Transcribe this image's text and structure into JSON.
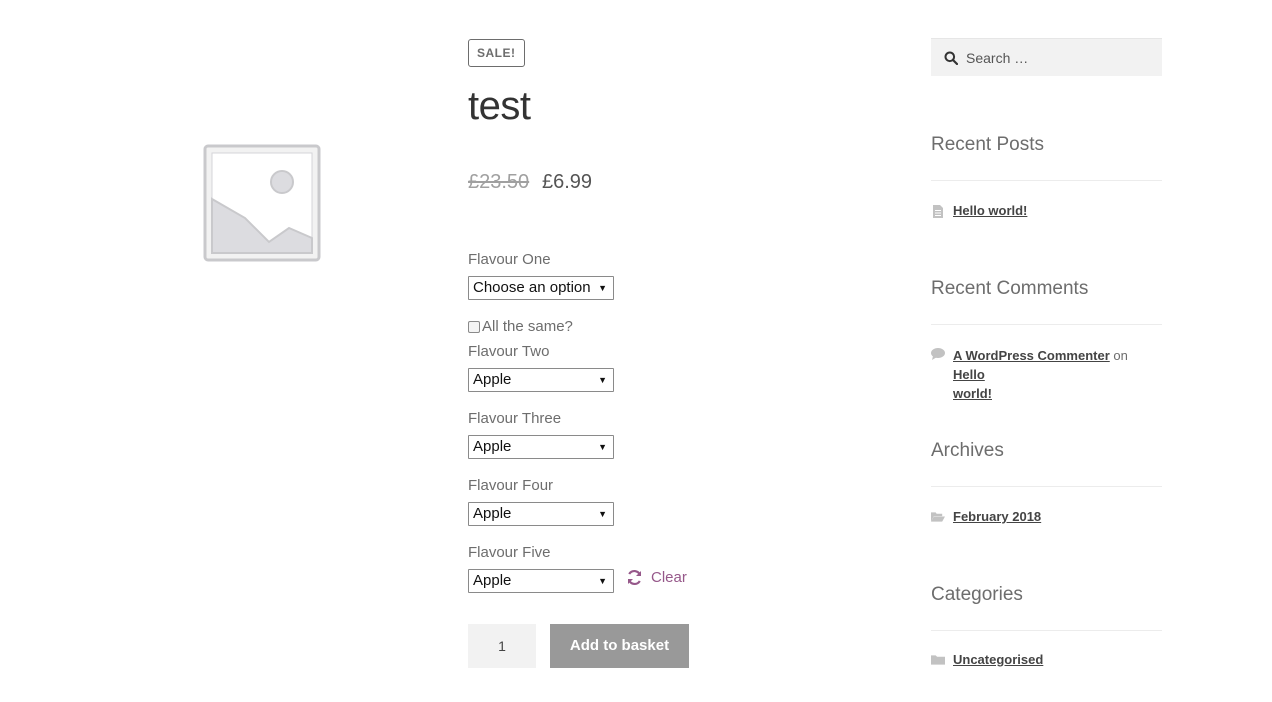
{
  "product": {
    "badge": "SALE!",
    "title": "test",
    "price_old": "£23.50",
    "price_new": "£6.99",
    "attributes": [
      {
        "label": "Flavour One",
        "value": "Choose an option"
      },
      {
        "label": "Flavour Two",
        "value": "Apple"
      },
      {
        "label": "Flavour Three",
        "value": "Apple"
      },
      {
        "label": "Flavour Four",
        "value": "Apple"
      },
      {
        "label": "Flavour Five",
        "value": "Apple"
      }
    ],
    "checkbox_label": "All the same?",
    "clear_label": "Clear",
    "quantity": "1",
    "add_to_basket": "Add to basket"
  },
  "sidebar": {
    "search_placeholder": "Search …",
    "recent_posts": {
      "title": "Recent Posts",
      "items": [
        "Hello world!"
      ]
    },
    "recent_comments": {
      "title": "Recent Comments",
      "author": "A WordPress Commenter",
      "connector": "on",
      "post_line1": "Hello",
      "post_line2": "world!"
    },
    "archives": {
      "title": "Archives",
      "items": [
        "February 2018"
      ]
    },
    "categories": {
      "title": "Categories",
      "items": [
        "Uncategorised"
      ]
    }
  },
  "colors": {
    "accent": "#96588a",
    "button": "#999999",
    "text": "#6d6d6d"
  }
}
